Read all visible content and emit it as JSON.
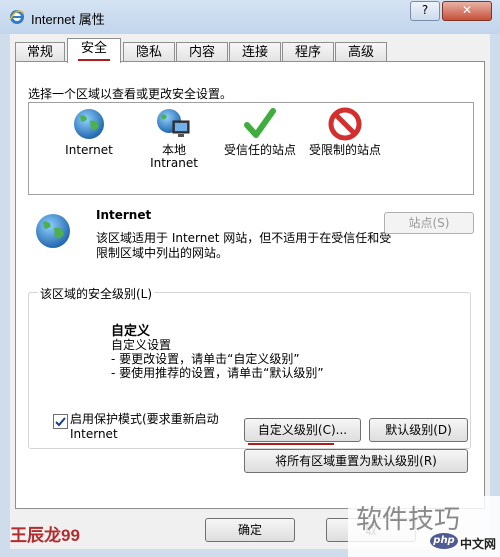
{
  "window": {
    "title": "Internet 属性",
    "help_label": "?",
    "close_label": "✕"
  },
  "tabs": [
    {
      "label": "常规"
    },
    {
      "label": "安全",
      "active": true
    },
    {
      "label": "隐私"
    },
    {
      "label": "内容"
    },
    {
      "label": "连接"
    },
    {
      "label": "程序"
    },
    {
      "label": "高级"
    }
  ],
  "security": {
    "prompt": "选择一个区域以查看或更改安全设置。",
    "zones": [
      {
        "label": "Internet",
        "icon": "globe-icon"
      },
      {
        "label": "本地\nIntranet",
        "icon": "intranet-icon"
      },
      {
        "label": "受信任的站点",
        "icon": "checkmark-icon"
      },
      {
        "label": "受限制的站点",
        "icon": "restricted-icon"
      }
    ],
    "selected_zone": {
      "name": "Internet",
      "description": "该区域适用于 Internet 网站，但不适用于在受信任和受限制区域中列出的网站。"
    },
    "sites_button": "站点(S)",
    "level_group_label": "该区域的安全级别(L)",
    "level_name": "自定义",
    "level_lines": [
      "自定义设置",
      "- 要更改设置，请单击“自定义级别”",
      "- 要使用推荐的设置，请单击“默认级别”"
    ],
    "protected_mode": {
      "checked": true,
      "label": "启用保护模式(要求重新启动 Internet"
    },
    "custom_level_button": "自定义级别(C)...",
    "default_level_button": "默认级别(D)",
    "reset_all_button": "将所有区域重置为默认级别(R)"
  },
  "footer": {
    "ok": "确定",
    "cancel": "取"
  },
  "watermarks": {
    "author": "王辰龙99",
    "site_text": "软件技巧",
    "logo_text": "php",
    "site_name": "中文网"
  },
  "colors": {
    "accent_underline": "#b01c1c",
    "titlebar": "#c2d5ec"
  }
}
